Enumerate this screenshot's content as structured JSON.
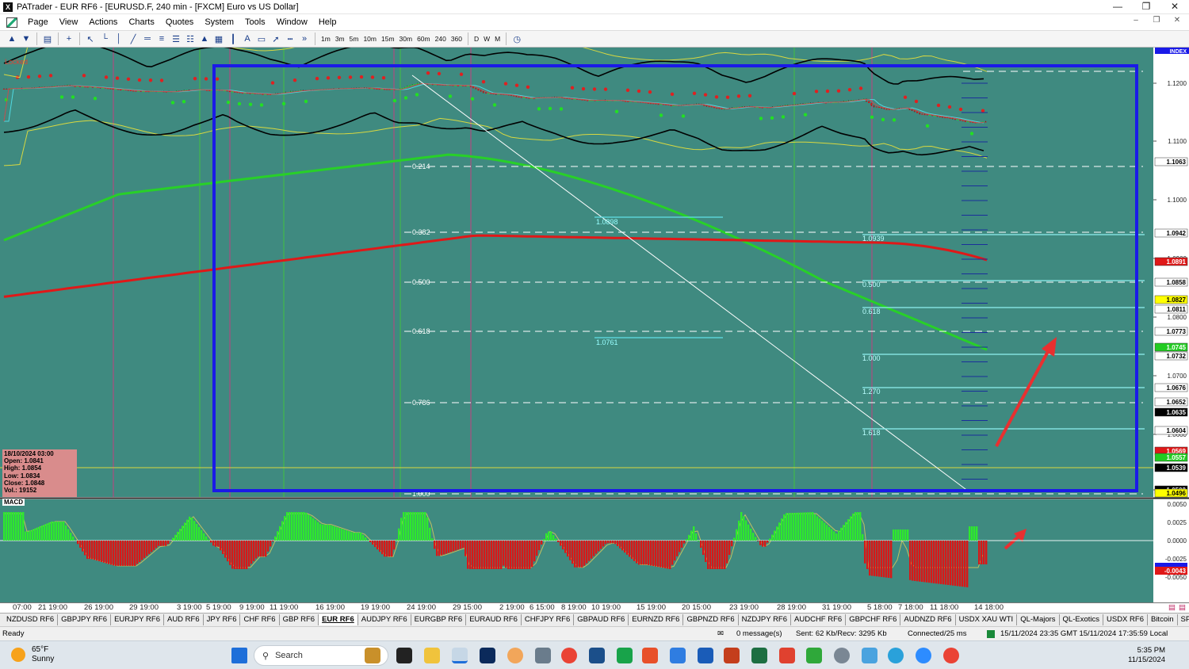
{
  "window": {
    "title": "PATrader - EUR RF6 - [EURUSD.F, 240 min - [FXCM] Euro vs US Dollar]",
    "app_icon_glyph": "X"
  },
  "menu": [
    "Page",
    "View",
    "Actions",
    "Charts",
    "Quotes",
    "System",
    "Tools",
    "Window",
    "Help"
  ],
  "timeframes": [
    "1m",
    "3m",
    "5m",
    "10m",
    "15m",
    "30m",
    "60m",
    "240",
    "360",
    "D",
    "W",
    "M"
  ],
  "chart": {
    "locked_label": "Locked",
    "index_label": "INDEX",
    "macd_label": "MACD",
    "ohlc": {
      "date": "18/10/2024 03:00",
      "open": "Open: 1.0841",
      "high": "High: 1.0854",
      "low": "Low: 1.0834",
      "close": "Close: 1.0848",
      "vol": "Vol.: 19152"
    },
    "price_ticks": [
      "1.1200",
      "1.1100",
      "1.1000",
      "1.0900",
      "1.0800",
      "1.0700",
      "1.0600",
      "1.0500"
    ],
    "price_tags": [
      {
        "label": "1.1063",
        "bg": "#ffffff",
        "fg": "#000000"
      },
      {
        "label": "1.0942",
        "bg": "#ffffff",
        "fg": "#000000"
      },
      {
        "label": "1.0891",
        "bg": "#e01818",
        "fg": "#ffffff"
      },
      {
        "label": "1.0858",
        "bg": "#ffffff",
        "fg": "#000000"
      },
      {
        "label": "1.0827",
        "bg": "#ffff00",
        "fg": "#000000"
      },
      {
        "label": "1.0811",
        "bg": "#ffffff",
        "fg": "#000000"
      },
      {
        "label": "1.0773",
        "bg": "#ffffff",
        "fg": "#000000"
      },
      {
        "label": "1.0745",
        "bg": "#22cc22",
        "fg": "#ffffff"
      },
      {
        "label": "1.0732",
        "bg": "#ffffff",
        "fg": "#000000"
      },
      {
        "label": "1.0676",
        "bg": "#ffffff",
        "fg": "#000000"
      },
      {
        "label": "1.0652",
        "bg": "#ffffff",
        "fg": "#000000"
      },
      {
        "label": "1.0635",
        "bg": "#000000",
        "fg": "#ffffff"
      },
      {
        "label": "1.0604",
        "bg": "#ffffff",
        "fg": "#000000"
      },
      {
        "label": "1.0569",
        "bg": "#e01818",
        "fg": "#ffffff"
      },
      {
        "label": "1.0557",
        "bg": "#22cc22",
        "fg": "#ffffff"
      },
      {
        "label": "1.0539",
        "bg": "#000000",
        "fg": "#ffffff"
      },
      {
        "label": "1.0502",
        "bg": "#000000",
        "fg": "#ffffff"
      },
      {
        "label": "1.0496",
        "bg": "#ffff00",
        "fg": "#000000"
      }
    ],
    "fib_left": [
      "0.214",
      "0.382",
      "0.500",
      "0.618",
      "0.786",
      "1.000"
    ],
    "fib_right": [
      "1.0939",
      "0.500",
      "0.618",
      "1.000",
      "1.270",
      "1.618"
    ],
    "cyan_labels": [
      "1.0898",
      "1.0761"
    ],
    "macd_ticks": [
      "0.0050",
      "0.0025",
      "0.0000",
      "-0.0025",
      "-0.0050"
    ],
    "macd_tags": [
      {
        "label": "-0.0043",
        "bg": "#e01818",
        "fg": "#ffffff"
      }
    ],
    "x_ticks": [
      "07:00",
      "21 19:00",
      "26 19:00",
      "29 19:00",
      "3 19:00",
      "5 19:00",
      "9 19:00",
      "11 19:00",
      "16 19:00",
      "19 19:00",
      "24 19:00",
      "29 15:00",
      "2 19:00",
      "6 15:00",
      "8 19:00",
      "10 19:00",
      "15 19:00",
      "20 15:00",
      "23 19:00",
      "28 19:00",
      "31 19:00",
      "5 18:00",
      "7 18:00",
      "11 18:00",
      "14 18:00"
    ],
    "colors": {
      "bg": "#3f8a80",
      "frame": "#1a1ae8",
      "ema_red": "#e01818",
      "ema_green": "#28d028",
      "envelope": "#d8d840"
    }
  },
  "tabs": [
    "NZDUSD RF6",
    "GBPJPY RF6",
    "EURJPY RF6",
    "AUD RF6",
    "JPY RF6",
    "CHF RF6",
    "GBP RF6",
    "EUR RF6",
    "AUDJPY RF6",
    "EURGBP RF6",
    "EURAUD RF6",
    "CHFJPY RF6",
    "GBPAUD RF6",
    "EURNZD RF6",
    "GBPNZD RF6",
    "NZDJPY RF6",
    "AUDCHF RF6",
    "GBPCHF RF6",
    "AUDNZD RF6",
    "USDX XAU WTI",
    "QL-Majors",
    "QL-Exotics",
    "USDX RF6",
    "Bitcoin",
    "SP500 RF6",
    "DJIA"
  ],
  "active_tab": "EUR RF6",
  "status": {
    "ready": "Ready",
    "messages": "0 message(s)",
    "sent": "Sent: 62 Kb/Recv: 3295 Kb",
    "connected": "Connected/25 ms",
    "time": "15/11/2024 23:35 GMT  15/11/2024 17:35:59 Local"
  },
  "taskbar": {
    "temp": "65°F",
    "weather": "Sunny",
    "search": "Search",
    "clock_time": "5:35 PM",
    "clock_date": "11/15/2024"
  }
}
